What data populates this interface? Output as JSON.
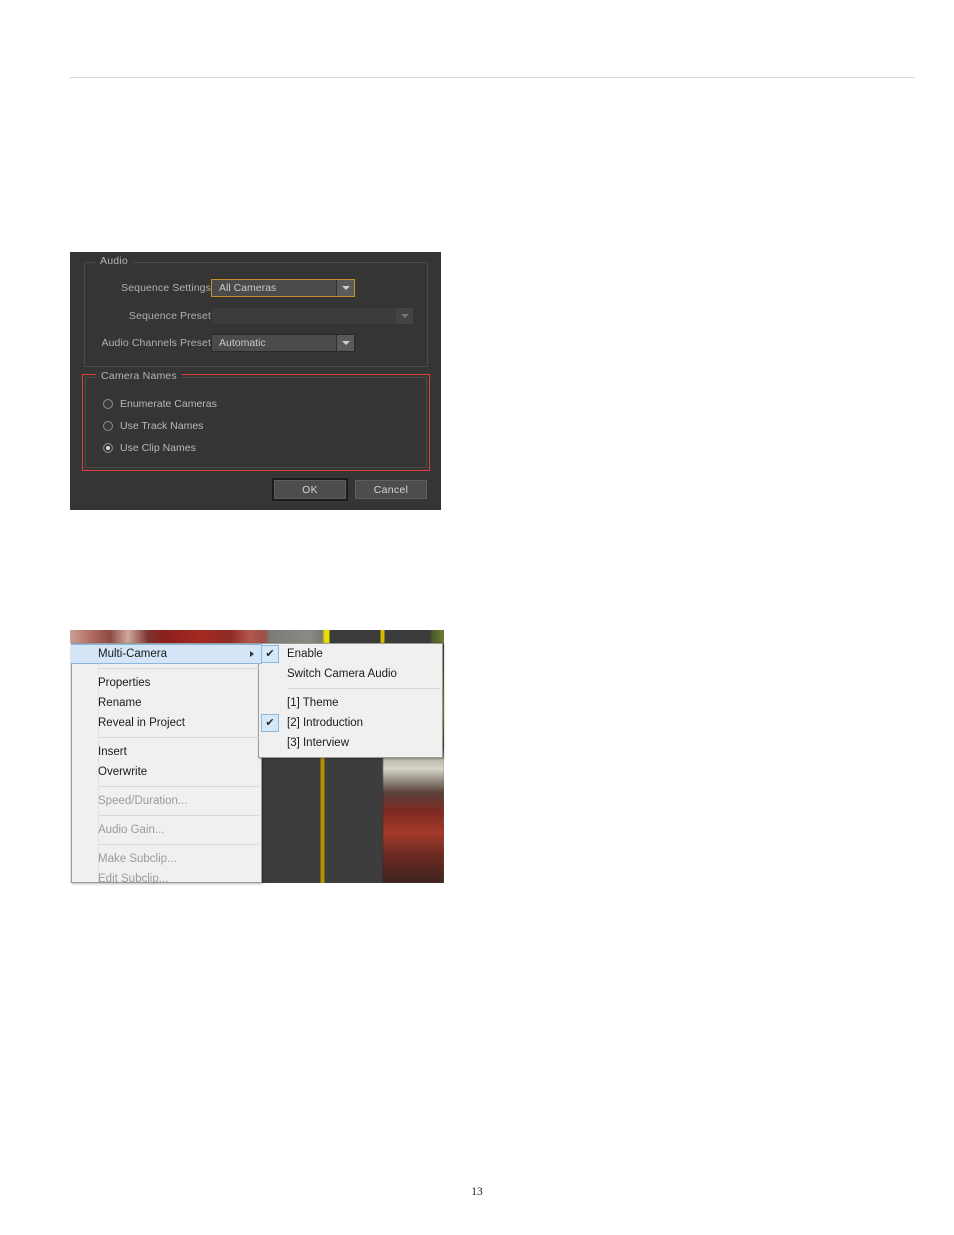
{
  "page": {
    "number": "13"
  },
  "dialog": {
    "audio_group": {
      "title": "Audio",
      "fields": [
        {
          "label": "Sequence Settings:",
          "value": "All Cameras",
          "state": "focused"
        },
        {
          "label": "Sequence Preset:",
          "value": "",
          "state": "disabled"
        },
        {
          "label": "Audio Channels Preset:",
          "value": "Automatic",
          "state": "normal"
        }
      ]
    },
    "camera_names_group": {
      "title": "Camera Names",
      "options": [
        {
          "label": "Enumerate Cameras",
          "checked": false
        },
        {
          "label": "Use Track Names",
          "checked": false
        },
        {
          "label": "Use Clip Names",
          "checked": true
        }
      ],
      "highlight_color": "#e0413c"
    },
    "buttons": {
      "ok": "OK",
      "cancel": "Cancel"
    }
  },
  "context_menu": {
    "items": [
      {
        "label": "Multi-Camera",
        "highlighted": true,
        "submenu": true,
        "disabled": false
      },
      {
        "separator": true
      },
      {
        "label": "Properties",
        "disabled": false
      },
      {
        "label": "Rename",
        "disabled": false
      },
      {
        "label": "Reveal in Project",
        "disabled": false
      },
      {
        "separator": true
      },
      {
        "label": "Insert",
        "disabled": false
      },
      {
        "label": "Overwrite",
        "disabled": false
      },
      {
        "separator": true
      },
      {
        "label": "Speed/Duration...",
        "disabled": true
      },
      {
        "separator": true
      },
      {
        "label": "Audio Gain...",
        "disabled": true
      },
      {
        "separator": true
      },
      {
        "label": "Make Subclip...",
        "disabled": true
      },
      {
        "label": "Edit Subclip...",
        "disabled": true
      }
    ]
  },
  "submenu": {
    "items": [
      {
        "label": "Enable",
        "checked": true
      },
      {
        "label": "Switch Camera Audio",
        "checked": false
      },
      {
        "separator": true
      },
      {
        "label": "[1] Theme",
        "checked": false
      },
      {
        "label": "[2] Introduction",
        "checked": true
      },
      {
        "label": "[3] Interview",
        "checked": false
      }
    ],
    "check_glyph": "✔"
  }
}
